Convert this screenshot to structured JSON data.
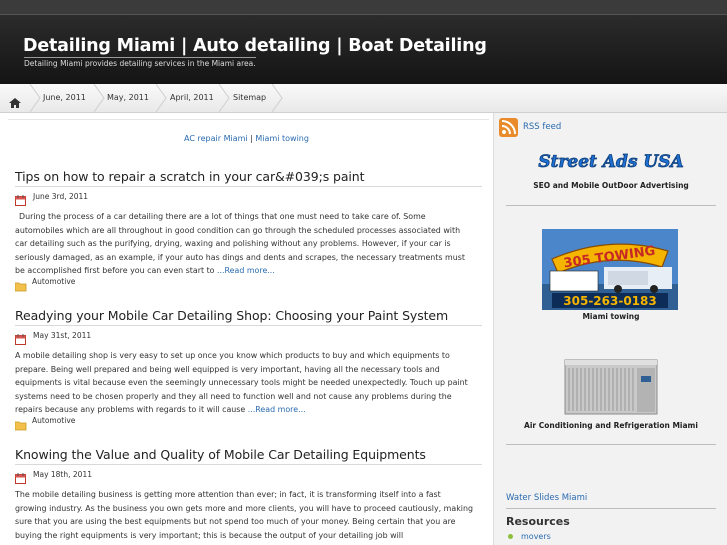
{
  "header": {
    "title": "Detailing Miami | Auto detailing | Boat Detailing",
    "description": "Detailing Miami provides detailing services in the Miami area."
  },
  "nav": {
    "items": [
      "June, 2011",
      "May, 2011",
      "April, 2011",
      "Sitemap"
    ]
  },
  "content": {
    "links": [
      "AC repair Miami",
      "|",
      "Miami towing"
    ],
    "posts": [
      {
        "title": "Tips on how to repair a scratch in your car&#039;s paint",
        "date": "June 3rd, 2011",
        "body": "During the process of a car detailing there are a lot of things that one must need to take care of. Some automobiles which are all throughout in good condition can go through the scheduled processes associated with car detailing such as the purifying, drying, waxing and polishing without any problems. However, if your car is seriously damaged, as an example, if your auto has dings and dents and scrapes, the necessary treatments must be accomplished first before you can even start to ",
        "more": "...Read more...",
        "category": "Automotive"
      },
      {
        "title": "Readying your Mobile Car Detailing Shop: Choosing your Paint System",
        "date": "May 31st, 2011",
        "body": "A mobile detailing shop is very easy to set up once you know which products to buy and which equipments to prepare. Being well prepared and being well equipped is very important, having all the necessary tools and equipments is vital because even the seemingly unnecessary tools might be needed unexpectedly. Touch up paint systems need to be chosen properly and they all need to function well and not cause any problems during the repairs because any problems with regards to it will cause ",
        "more": "...Read more...",
        "category": "Automotive"
      },
      {
        "title": "Knowing the Value and Quality of Mobile Car Detailing Equipments",
        "date": "May 18th, 2011",
        "body": "The mobile detailing business is getting more attention than ever; in fact, it is transforming itself into a fast growing industry. As the business you own gets more and more clients, you will have to proceed cautiously, making sure that you are using the best equipments but not spend too much of your money. Being certain that you are buying the right equipments is very important; this is because the output of your detailing job will"
      }
    ]
  },
  "sidebar": {
    "rss_label": "RSS feed",
    "street_ads_logo": "Street Ads USA",
    "street_ads_caption": "SEO and Mobile OutDoor Advertising",
    "towing_image_text": "305 TOWING",
    "towing_phone": "305-263-0183",
    "towing_caption": "Miami towing",
    "ac_caption": "Air Conditioning and Refrigeration Miami",
    "water_slides_link": "Water Slides Miami",
    "resources_title": "Resources",
    "resources_items": [
      "movers"
    ]
  },
  "colors": {
    "link": "#2a6bb0",
    "header_bg": "#1f1f1f",
    "accent_green": "#8bbf3a"
  }
}
